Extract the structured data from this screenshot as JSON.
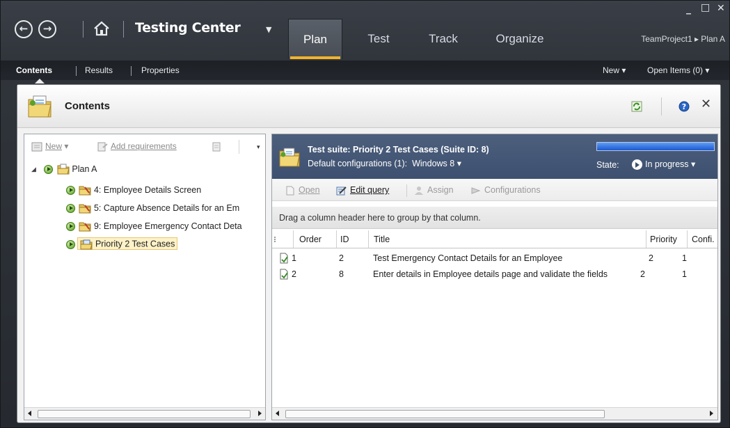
{
  "title_bar": {
    "app_title": "Testing Center",
    "tabs": [
      {
        "label": "Plan",
        "active": true
      },
      {
        "label": "Test",
        "active": false
      },
      {
        "label": "Track",
        "active": false
      },
      {
        "label": "Organize",
        "active": false
      }
    ],
    "breadcrumb": "TeamProject1 ▸ Plan A",
    "window_controls": {
      "minimize": "_",
      "maximize": "□",
      "close": "✕"
    }
  },
  "subnav": {
    "items": [
      {
        "label": "Contents",
        "active": true
      },
      {
        "label": "Results",
        "active": false
      },
      {
        "label": "Properties",
        "active": false
      }
    ],
    "new_label": "New ▾",
    "open_items_label": "Open Items (0) ▾"
  },
  "panel": {
    "title": "Contents"
  },
  "tree_toolbar": {
    "new_label": "New",
    "add_requirements_label": "Add requirements"
  },
  "tree": {
    "root": "Plan A",
    "children": [
      {
        "label": "4: Employee Details Screen"
      },
      {
        "label": "5: Capture Absence Details for an Em"
      },
      {
        "label": "9: Employee Emergency Contact Deta"
      },
      {
        "label": "Priority 2 Test Cases",
        "selected": true
      }
    ]
  },
  "suite": {
    "title": "Test suite:  Priority 2 Test Cases (Suite ID: 8)",
    "default_config_label": "Default configurations (1):",
    "default_config_value": "Windows 8 ▾",
    "state_label": "State:",
    "state_value": "In progress ▾",
    "progress": 1.0,
    "progress_color": "#1e5fd6"
  },
  "right_toolbar": {
    "open_label": "Open",
    "edit_query_label": "Edit query",
    "assign_label": "Assign",
    "configurations_label": "Configurations"
  },
  "group_hint": "Drag a column header here to group by that column.",
  "grid": {
    "columns": [
      "Order",
      "ID",
      "Title",
      "Priority",
      "Confi."
    ],
    "rows": [
      {
        "order": "1",
        "id": "2",
        "title": "Test Emergency Contact Details for an Employee",
        "priority": "2",
        "config": "1"
      },
      {
        "order": "2",
        "id": "8",
        "title": "Enter details in Employee details page and validate the fields",
        "priority": "2",
        "config": "1"
      }
    ]
  },
  "colors": {
    "accent_underline": "#f0b32c",
    "suite_header_bg": "#4c5f7c",
    "chrome_dark": "#30343b"
  }
}
